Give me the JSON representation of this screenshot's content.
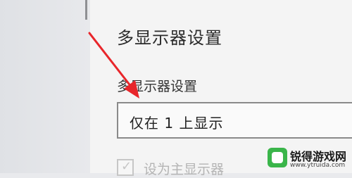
{
  "settings": {
    "section_title": "多显示器设置",
    "dropdown_label": "多显示器设置",
    "dropdown_value": "仅在 1 上显示",
    "checkbox_label": "设为主显示器"
  },
  "watermark": {
    "name": "锐得游戏网",
    "url": "www.ytruida.com"
  },
  "colors": {
    "arrow": "#e8262b",
    "panel_bg": "#f4f4f4",
    "dropdown_border": "#8a8a8a",
    "watermark_green": "#3ab54a"
  },
  "icons": {
    "arrow": "red-arrow-icon",
    "checkbox": "checkbox-icon",
    "logo": "watermark-logo-icon"
  }
}
